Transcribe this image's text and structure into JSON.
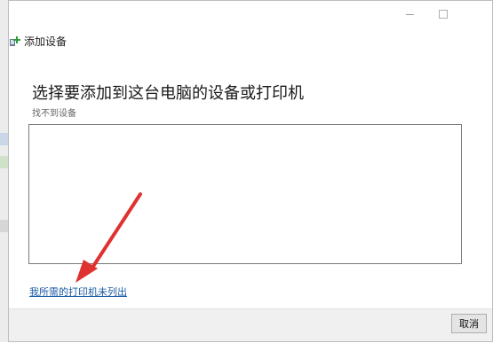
{
  "window": {
    "title": "添加设备",
    "controls": {
      "minimize_icon": "minimize-icon",
      "maximize_icon": "maximize-icon"
    }
  },
  "main": {
    "heading": "选择要添加到这台电脑的设备或打印机",
    "status": "找不到设备",
    "device_list": []
  },
  "link": {
    "label": "我所需的打印机未列出"
  },
  "footer": {
    "cancel_label": "取消"
  },
  "colors": {
    "accent_link": "#1a5aa6",
    "annotation_arrow": "#e03131"
  }
}
